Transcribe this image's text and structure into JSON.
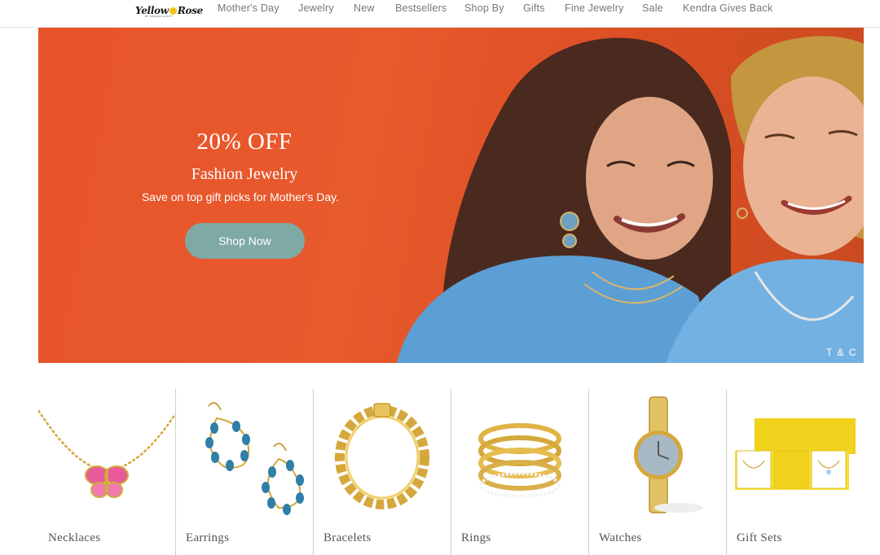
{
  "header": {
    "logo_text_left": "Yellow",
    "logo_text_right": "Rose",
    "logo_subtext": "BY KENDRA SCOTT",
    "nav": [
      {
        "label": "Mother's Day"
      },
      {
        "label": "Jewelry"
      },
      {
        "label": "New"
      },
      {
        "label": "Bestsellers"
      },
      {
        "label": "Shop By"
      },
      {
        "label": "Gifts"
      },
      {
        "label": "Fine Jewelry"
      },
      {
        "label": "Sale"
      },
      {
        "label": "Kendra Gives Back"
      }
    ]
  },
  "hero": {
    "headline": "20% OFF",
    "subheadline": "Fashion Jewelry",
    "description": "Save on top gift picks for Mother's Day.",
    "cta_label": "Shop Now",
    "terms_label": "T & C",
    "background_color": "#e8542c",
    "button_color": "#7fa9a4"
  },
  "categories": [
    {
      "label": "Necklaces",
      "icon": "necklace-image"
    },
    {
      "label": "Earrings",
      "icon": "earrings-image"
    },
    {
      "label": "Bracelets",
      "icon": "bracelet-image"
    },
    {
      "label": "Rings",
      "icon": "rings-image"
    },
    {
      "label": "Watches",
      "icon": "watch-image"
    },
    {
      "label": "Gift Sets",
      "icon": "gift-set-image"
    }
  ]
}
